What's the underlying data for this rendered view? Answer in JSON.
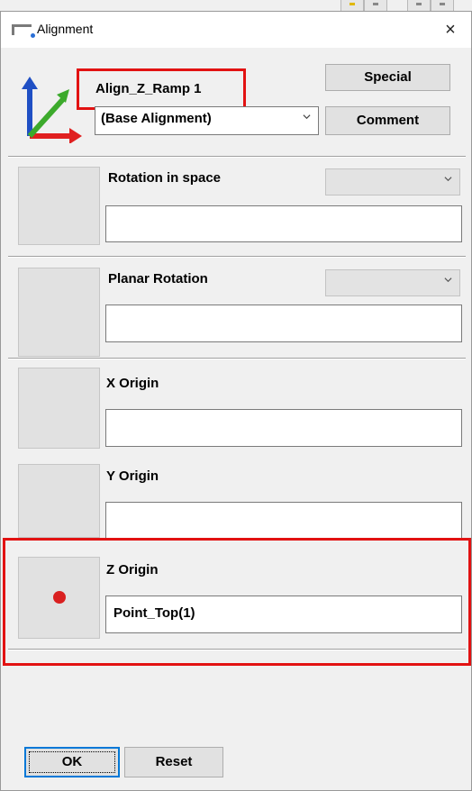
{
  "window": {
    "title": "Alignment",
    "close_glyph": "×"
  },
  "header": {
    "alignment_name": "Align_Z_Ramp 1",
    "base_select_value": "(Base Alignment)",
    "special_label": "Special",
    "comment_label": "Comment"
  },
  "rows": {
    "rotation_space": {
      "label": "Rotation in space",
      "value": ""
    },
    "planar_rotation": {
      "label": "Planar Rotation",
      "value": ""
    },
    "x_origin": {
      "label": "X Origin",
      "value": ""
    },
    "y_origin": {
      "label": "Y Origin",
      "value": ""
    },
    "z_origin": {
      "label": "Z Origin",
      "value": "Point_Top(1)"
    }
  },
  "footer": {
    "ok_label": "OK",
    "reset_label": "Reset"
  },
  "colors": {
    "highlight": "#e21212",
    "point_marker": "#d92020",
    "focus": "#0078d7"
  },
  "icons": [
    "window-icon",
    "close-icon",
    "axis-system-icon",
    "chevron-down-icon",
    "point-icon"
  ]
}
